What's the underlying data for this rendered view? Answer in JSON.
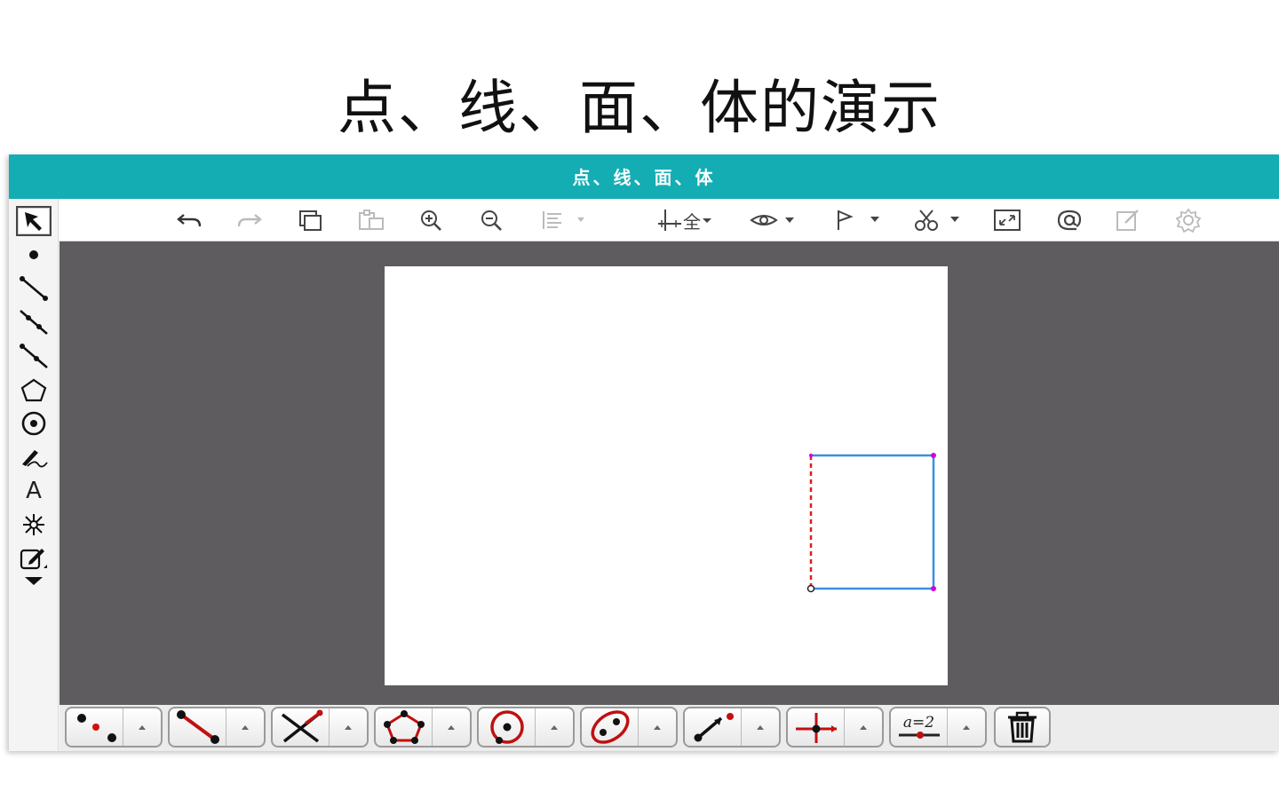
{
  "slide": {
    "title": "点、线、面、体的演示"
  },
  "window": {
    "title": "点、线、面、体"
  },
  "toolbar": {
    "items": [
      {
        "name": "undo-icon"
      },
      {
        "name": "redo-icon"
      },
      {
        "name": "copy-icon"
      },
      {
        "name": "paste-icon"
      },
      {
        "name": "zoom-in-icon"
      },
      {
        "name": "zoom-out-icon"
      },
      {
        "name": "align-icon"
      },
      {
        "name": "axis-icon"
      },
      {
        "name": "eye-icon"
      },
      {
        "name": "flag-icon"
      },
      {
        "name": "scissors-icon"
      },
      {
        "name": "fullscreen-icon"
      },
      {
        "name": "at-icon"
      },
      {
        "name": "edit-icon"
      },
      {
        "name": "settings-icon"
      }
    ],
    "axis_label": "全"
  },
  "left_tools": {
    "text_tool_label": "A",
    "items": [
      "select-arrow-icon",
      "point-icon",
      "segment-icon",
      "line-icon",
      "ray-icon",
      "polygon-icon",
      "circle-icon",
      "freehand-icon",
      "text-icon",
      "transform-icon",
      "edit-icon",
      "more-icon"
    ]
  },
  "bottom_tools": {
    "groups": [
      "points-icon",
      "segment-icon",
      "intersect-icon",
      "polygon-icon",
      "circle-icon",
      "ellipse-icon",
      "vector-icon",
      "axis-icon",
      "formula-icon"
    ],
    "formula_label": "a=2",
    "trash": "trash-icon"
  },
  "colors": {
    "titlebar": "#14adb4",
    "workarea": "#5e5c5e",
    "rect_stroke": "#3b8fe0",
    "dashed_edge": "#e02020",
    "vertex": "#d400d4"
  }
}
